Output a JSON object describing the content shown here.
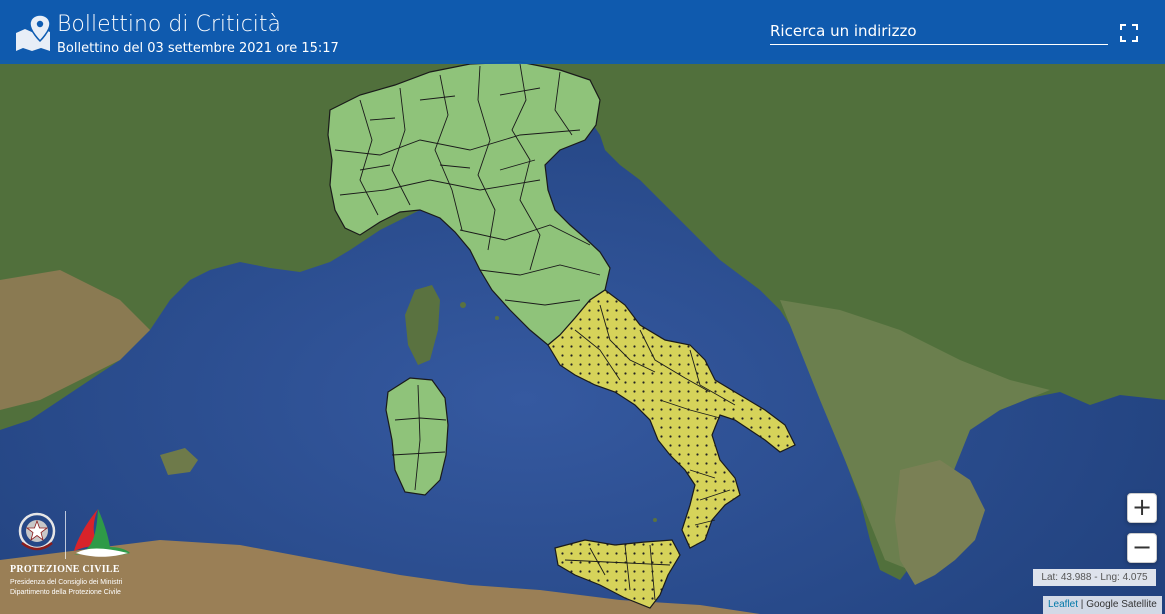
{
  "header": {
    "title": "Bollettino di Criticità",
    "subtitle": "Bollettino del 03 settembre 2021 ore 15:17",
    "search_placeholder": "Ricerca un indirizzo"
  },
  "map": {
    "zoom_in_label": "+",
    "zoom_out_label": "−",
    "coords_readout": "Lat: 43.988 - Lng: 4.075",
    "attribution_link": "Leaflet",
    "attribution_separator": " | ",
    "attribution_text": "Google Satellite",
    "alert_colors": {
      "green": "#8fc37a",
      "yellow": "#d6d35a"
    }
  },
  "logo": {
    "name": "PROTEZIONE CIVILE",
    "line1": "Presidenza del Consiglio dei Ministri",
    "line2": "Dipartimento della Protezione Civile"
  },
  "colors": {
    "header_bg": "#0e5cb2",
    "sea": "#2b4f8e",
    "land": "#4f6b3a"
  }
}
